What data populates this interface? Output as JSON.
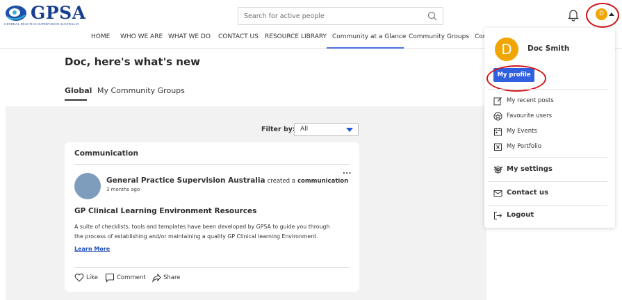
{
  "header": {
    "logo_text": "GPSA",
    "logo_subtext": "GENERAL PRACTICE SUPERVISION AUSTRALIA",
    "search_placeholder": "Search for active people",
    "avatar_initial": "D",
    "brand_color": "#173f8f",
    "avatar_color": "#f1a500",
    "annotation_color": "#d1161b"
  },
  "nav": {
    "items": [
      {
        "label": "HOME"
      },
      {
        "label": "WHO WE ARE"
      },
      {
        "label": "WHAT WE DO"
      },
      {
        "label": "CONTACT US"
      },
      {
        "label": "RESOURCE LIBRARY"
      },
      {
        "label": "Community at a Glance",
        "active": true
      },
      {
        "label": "Community Groups"
      },
      {
        "label": "Com"
      }
    ],
    "accent_color": "#4a6fe0"
  },
  "main": {
    "title": "Doc, here's what's new",
    "tabs": [
      {
        "label": "Global",
        "active": true
      },
      {
        "label": "My Community Groups"
      }
    ],
    "filter": {
      "label": "Filter by:",
      "value": "All"
    },
    "card": {
      "title": "Communication",
      "author": "General Practice Supervision Australia",
      "action": "created a",
      "type": "communication",
      "time": "3 months ago",
      "more": "...",
      "heading": "GP Clinical Learning Environment Resources",
      "body_line1": "A suite of checklists, tools and templates have been developed by GPSA to guide you through",
      "body_line2": "the process of establishing and/or maintaining a quality GP Clinical learning Environment.",
      "link": "Learn More",
      "actions": {
        "like": "Like",
        "comment": "Comment",
        "share": "Share"
      }
    }
  },
  "dropdown": {
    "avatar_initial": "D",
    "name": "Doc Smith",
    "profile_button": "My profile",
    "items": [
      {
        "label": "My recent posts",
        "icon": "edit-icon"
      },
      {
        "label": "Favourite users",
        "icon": "star-circle-icon"
      },
      {
        "label": "My Events",
        "icon": "calendar-icon"
      },
      {
        "label": "My Portfolio",
        "icon": "portfolio-icon"
      }
    ],
    "settings": "My settings",
    "contact": "Contact us",
    "logout": "Logout",
    "button_color": "#3060e0"
  }
}
